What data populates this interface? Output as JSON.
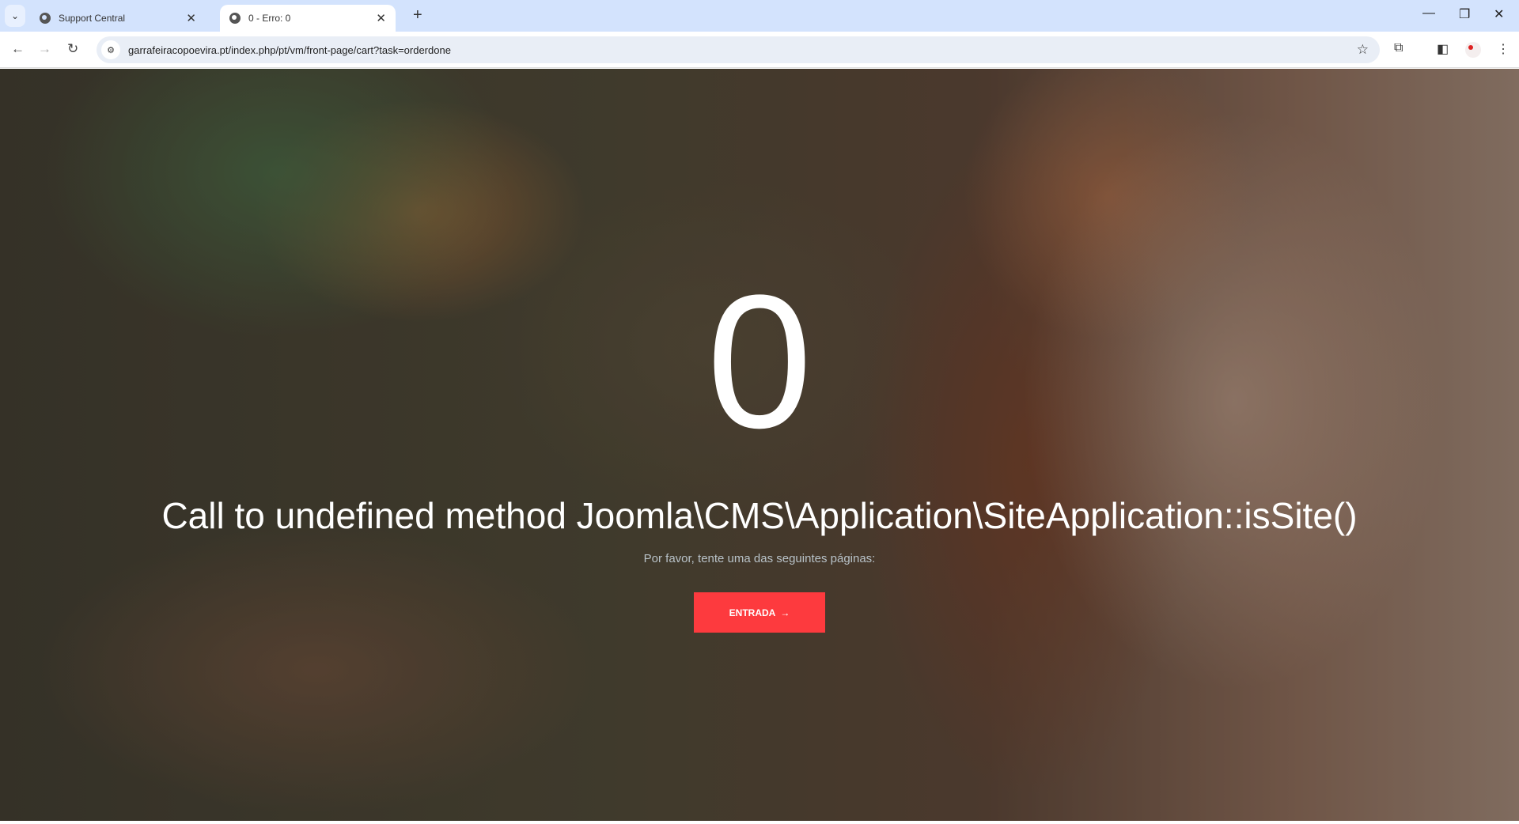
{
  "browser": {
    "tabs": [
      {
        "title": "Support Central",
        "active": false
      },
      {
        "title": "0 - Erro: 0",
        "active": true
      }
    ],
    "url": "garrafeiracopoevira.pt/index.php/pt/vm/front-page/cart?task=orderdone"
  },
  "page": {
    "error_code": "0",
    "error_message": "Call to undefined method Joomla\\CMS\\Application\\SiteApplication::isSite()",
    "subtitle": "Por favor, tente uma das seguintes páginas:",
    "button_label": "ENTRADA",
    "button_icon": "→",
    "button_color": "#fd3a3e"
  }
}
